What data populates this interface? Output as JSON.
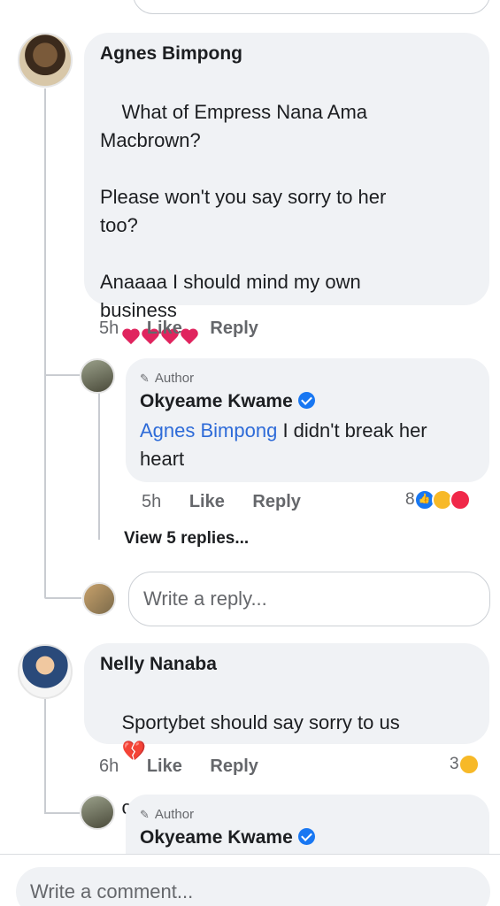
{
  "comments": [
    {
      "name": "Agnes Bimpong",
      "text": "What of Empress Nana Ama\nMacbrown?\n\nPlease won't you say sorry to her\ntoo?\n\nAnaaaa I should mind my own\nbusiness",
      "time": "5h",
      "like_label": "Like",
      "reply_label": "Reply",
      "reply": {
        "author_tag": "Author",
        "name": "Okyeame Kwame",
        "mention": "Agnes Bimpong",
        "text": " I didn't break her\nheart",
        "time": "5h",
        "like_label": "Like",
        "reply_label": "Reply",
        "reaction_count": "8"
      },
      "view_replies": "View 5 replies...",
      "reply_placeholder": "Write a reply..."
    },
    {
      "name": "Nelly Nanaba",
      "text_line1": "Sportybet should say sorry to us",
      "text_line2": "cuz eii",
      "time": "6h",
      "like_label": "Like",
      "reply_label": "Reply",
      "reaction_count": "3",
      "reply": {
        "author_tag": "Author",
        "name": "Okyeame Kwame"
      }
    }
  ],
  "footer": {
    "comment_placeholder": "Write a comment..."
  },
  "icons": {
    "verified": "verified-badge-icon",
    "pen": "pen-icon",
    "heart": "red-heart-icon",
    "broken_heart": "broken-heart-icon",
    "laugh": "laughing-face-icon"
  },
  "colors": {
    "bubble": "#f0f2f5",
    "mention": "#2e6bd8",
    "meta": "#65676b",
    "verified": "#1877f2"
  }
}
